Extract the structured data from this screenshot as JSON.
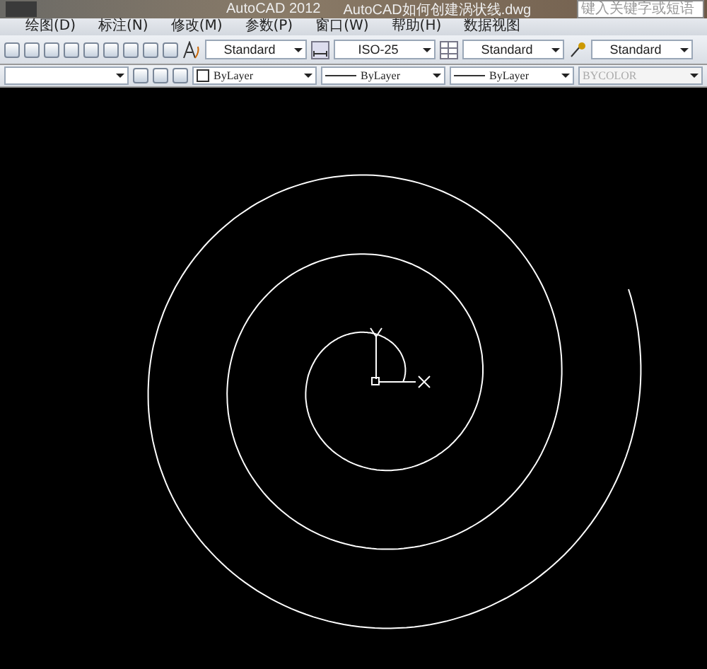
{
  "title_bar": {
    "app": "AutoCAD 2012",
    "file": "AutoCAD如何创建涡状线.dwg",
    "search": {
      "placeholder": "键入关键字或短语"
    }
  },
  "menu": [
    "绘图(D)",
    "标注(N)",
    "修改(M)",
    "参数(P)",
    "窗口(W)",
    "帮助(H)",
    "数据视图"
  ],
  "styles_toolbar": [
    {
      "kind": "text",
      "value": "Standard"
    },
    {
      "kind": "dim",
      "value": "ISO-25"
    },
    {
      "kind": "table",
      "value": "Standard"
    },
    {
      "kind": "leader",
      "value": "Standard"
    }
  ],
  "properties_toolbar": [
    {
      "kind": "color",
      "value": "ByLayer",
      "disabled": false
    },
    {
      "kind": "line",
      "value": "ByLayer",
      "disabled": false
    },
    {
      "kind": "line",
      "value": "ByLayer",
      "disabled": false
    },
    {
      "kind": "plain",
      "value": "BYCOLOR",
      "disabled": true
    }
  ]
}
